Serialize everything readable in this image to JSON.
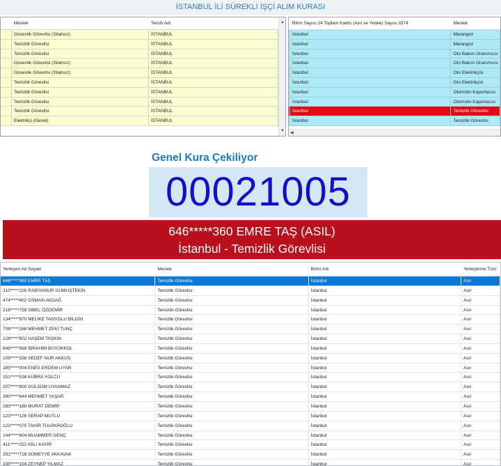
{
  "window_title": "İSTANBUL İLİ SÜREKLİ İŞÇİ ALIM KURASI",
  "top_left_grid": {
    "headers": [
      "",
      "Meslek",
      "Tercih Adı"
    ],
    "rows": [
      [
        "",
        "Güvenlik Görevlisi (Silahsız)",
        "İSTANBUL"
      ],
      [
        "",
        "Temizlik Görevlisi",
        "İSTANBUL"
      ],
      [
        "",
        "Temizlik Görevlisi",
        "İSTANBUL"
      ],
      [
        "",
        "Güvenlik Görevlisi (Silahsız)",
        "İSTANBUL"
      ],
      [
        "",
        "Güvenlik Görevlisi (Silahsız)",
        "İSTANBUL"
      ],
      [
        "",
        "Temizlik Görevlisi",
        "İSTANBUL"
      ],
      [
        "",
        "Temizlik Görevlisi",
        "İSTANBUL"
      ],
      [
        "",
        "Temizlik Görevlisi",
        "İSTANBUL"
      ],
      [
        "",
        "Temizlik Görevlisi",
        "İSTANBUL"
      ],
      [
        "",
        "Elektrikçi (Genel)",
        "İSTANBUL"
      ]
    ]
  },
  "top_right_grid": {
    "headers": [
      "",
      "Birim Sayısı:24 Toplam Kadro (Asıl ve Yedek) Sayısı:3374",
      "Meslek"
    ],
    "selected_index": 8,
    "rows": [
      [
        "",
        "İstanbul",
        "Marangoz"
      ],
      [
        "",
        "İstanbul",
        "Marangoz"
      ],
      [
        "",
        "İstanbul",
        "Oto Bakım Onarımcısı"
      ],
      [
        "",
        "İstanbul",
        "Oto Bakım Onarımcısı"
      ],
      [
        "",
        "İstanbul",
        "Oto Elektrikçisi"
      ],
      [
        "",
        "İstanbul",
        "Oto Elektrikçisi"
      ],
      [
        "",
        "İstanbul",
        "Otomotiv Kaportacısı"
      ],
      [
        "",
        "İstanbul",
        "Otomotiv Kaportacısı"
      ],
      [
        "",
        "İstanbul",
        "Temizlik Görevlisi"
      ],
      [
        "",
        "İstanbul",
        "Temizlik Görevlisi"
      ]
    ]
  },
  "kura": {
    "label": "Genel Kura Çekiliyor",
    "number": "00021005"
  },
  "winner": {
    "line1": "646*****360 EMRE TAŞ (ASIL)",
    "line2": "İstanbul - Temizlik Görevlisi"
  },
  "bottom_grid": {
    "headers": [
      "Yerleşen Ad Soyad",
      "Meslek",
      "Birim Adı",
      "Yerleştirme Türü"
    ],
    "selected_index": 0,
    "rows": [
      [
        "646*****360 EMRE TAŞ",
        "Temizlik Görevlisi",
        "İstanbul",
        "Asıl"
      ],
      [
        "310*****226 RABİYANUR GÜMÜŞTEKİN",
        "Temizlik Görevlisi",
        "İstanbul",
        "Asıl"
      ],
      [
        "474*****402 OSMAN AKDAĞ",
        "Temizlik Görevlisi",
        "İstanbul",
        "Asıl"
      ],
      [
        "218*****758 SİBEL ÖZDEMİR",
        "Temizlik Görevlisi",
        "İstanbul",
        "Asıl"
      ],
      [
        "134*****970 MELİKE TANYOLU BİLGİN",
        "Temizlik Görevlisi",
        "İstanbul",
        "Asıl"
      ],
      [
        "708*****268 MEHMET ZEKİ TUNÇ",
        "Temizlik Görevlisi",
        "İstanbul",
        "Asıl"
      ],
      [
        "128*****502 HAŞEM TAŞKIN",
        "Temizlik Görevlisi",
        "İstanbul",
        "Asıl"
      ],
      [
        "649*****568 İBRAHİM BÜYÜKKOL",
        "Temizlik Görevlisi",
        "İstanbul",
        "Asıl"
      ],
      [
        "109*****338 SEDEF NUR AKKUŞ",
        "Temizlik Görevlisi",
        "İstanbul",
        "Asıl"
      ],
      [
        "285*****004 ENES ERDEM UYAR",
        "Temizlik Görevlisi",
        "İstanbul",
        "Asıl"
      ],
      [
        "151*****538 KÜBRA YOLCU",
        "Temizlik Görevlisi",
        "İstanbul",
        "Asıl"
      ],
      [
        "207*****800 GÜLSÜM UYANMAZ",
        "Temizlik Görevlisi",
        "İstanbul",
        "Asıl"
      ],
      [
        "390*****644 MEHMET YAŞAR",
        "Temizlik Görevlisi",
        "İstanbul",
        "Asıl"
      ],
      [
        "283*****188 MURAT DEMİR",
        "Temizlik Görevlisi",
        "İstanbul",
        "Asıl"
      ],
      [
        "123*****126 SERAP MUTLU",
        "Temizlik Görevlisi",
        "İstanbul",
        "Asıl"
      ],
      [
        "122*****070 TAHİR TULPAROĞLU",
        "Temizlik Görevlisi",
        "İstanbul",
        "Asıl"
      ],
      [
        "144*****804 MUAMMER GENÇ",
        "Temizlik Görevlisi",
        "İstanbul",
        "Asıl"
      ],
      [
        "411*****252 ASLI KAYIR",
        "Temizlik Görevlisi",
        "İstanbul",
        "Asıl"
      ],
      [
        "291*****718 SÜMEYYE AKKAVAK",
        "Temizlik Görevlisi",
        "İstanbul",
        "Asıl"
      ],
      [
        "335*****104 ZEYNEP YILMAZ",
        "Temizlik Görevlisi",
        "İstanbul",
        "Asıl"
      ]
    ]
  },
  "colors": {
    "title_text": "#2a7bc4",
    "left_grid_bg": "#fdfdd2",
    "right_grid_bg": "#aee9f6",
    "right_selected_bg": "#e30613",
    "kura_label": "#1c7bbf",
    "kura_number": "#1010c8",
    "winner_band_bg": "#b9101d",
    "bottom_selected_bg": "#0a78d7"
  },
  "icons": {
    "scroll_up": "▲",
    "scroll_down": "▼",
    "scroll_left": "◀"
  }
}
